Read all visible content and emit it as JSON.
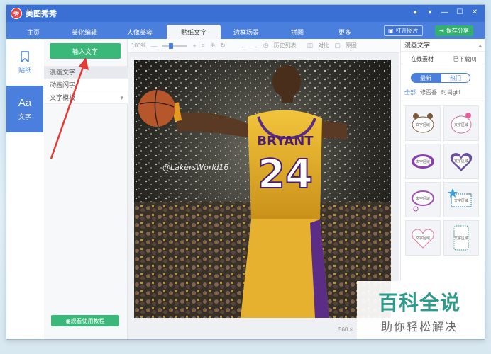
{
  "app": {
    "logo_glyph": "秀",
    "title": "美图秀秀"
  },
  "nav": {
    "tabs": [
      "主页",
      "美化编辑",
      "人像美容",
      "贴纸文字",
      "边框场景",
      "拼图",
      "更多"
    ],
    "active_index": 3,
    "open_image": "打开图片",
    "save_share": "保存分享"
  },
  "rail": {
    "items": [
      {
        "label": "贴纸",
        "icon": "bookmark-icon"
      },
      {
        "label": "文字",
        "icon": "text-aa-icon",
        "glyph": "Aa"
      }
    ]
  },
  "panel": {
    "input_text_button": "输入文字",
    "items": [
      "漫画文字",
      "动画闪字",
      "文字模板"
    ],
    "tutorial_button": "观看使用教程"
  },
  "toolbar": {
    "zoom": "100%",
    "history": "历史列表",
    "compare": "对比",
    "original": "原图"
  },
  "canvas": {
    "watermark_text": "@LakersWorld16",
    "jersey_name": "BRYANT",
    "jersey_number": "24",
    "image_size": "560 ×"
  },
  "right_panel": {
    "title": "漫画文字",
    "tabs": [
      "在线素材",
      "已下载[0]"
    ],
    "segments": [
      "最新",
      "热门"
    ],
    "filters": [
      "全部",
      "修否香",
      "时尚girl"
    ],
    "sticker_text": "文字区域"
  },
  "site_watermark": {
    "line1": "百科全说",
    "line2": "助你轻松解决"
  },
  "colors": {
    "accent": "#4a7fde",
    "green": "#39b87a",
    "brand_red": "#e8403c"
  }
}
